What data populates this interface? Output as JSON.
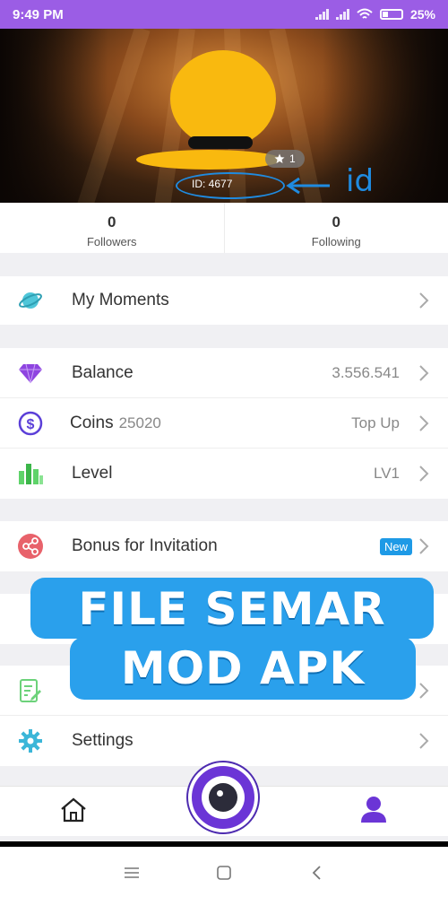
{
  "status_bar": {
    "time": "9:49 PM",
    "battery": "25%"
  },
  "profile": {
    "star_count": "1",
    "id_text": "ID: 4677",
    "id_annotation": "id"
  },
  "stats": [
    {
      "count": "0",
      "label": "Followers"
    },
    {
      "count": "0",
      "label": "Following"
    }
  ],
  "menu": {
    "moments": {
      "label": "My Moments",
      "icon": "planet-icon"
    },
    "balance": {
      "label": "Balance",
      "value": "3.556.541",
      "icon": "diamond-icon"
    },
    "coins": {
      "label": "Coins",
      "sub": "25020",
      "value": "Top Up",
      "icon": "dollar-coin-icon"
    },
    "level": {
      "label": "Level",
      "value": "LV1",
      "icon": "bar-chart-icon"
    },
    "invite": {
      "label": "Bonus for Invitation",
      "badge": "New",
      "icon": "share-icon"
    },
    "settings": {
      "label": "Settings",
      "icon": "gear-icon"
    }
  },
  "watermark": {
    "line1": "FILE SEMAR",
    "line2": "MOD APK"
  },
  "colors": {
    "accent": "#9b5de5",
    "brand_purple": "#6b35d6",
    "badge_blue": "#1e9ae6",
    "highlight_yellow": "#f9b90f"
  }
}
